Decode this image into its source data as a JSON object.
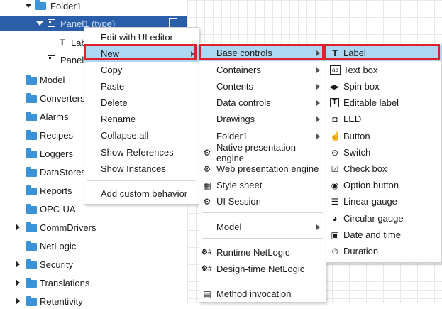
{
  "tree": {
    "folder1": "Folder1",
    "panel1": "Panel1 (type)",
    "label_child": "Lab",
    "panel_child": "Panel",
    "items": [
      {
        "label": "Model",
        "expandable": false
      },
      {
        "label": "Converters",
        "expandable": false
      },
      {
        "label": "Alarms",
        "expandable": false
      },
      {
        "label": "Recipes",
        "expandable": false
      },
      {
        "label": "Loggers",
        "expandable": false
      },
      {
        "label": "DataStores",
        "expandable": false
      },
      {
        "label": "Reports",
        "expandable": false
      },
      {
        "label": "OPC-UA",
        "expandable": false
      },
      {
        "label": "CommDrivers",
        "expandable": true
      },
      {
        "label": "NetLogic",
        "expandable": false
      },
      {
        "label": "Security",
        "expandable": true
      },
      {
        "label": "Translations",
        "expandable": true
      },
      {
        "label": "Retentivity",
        "expandable": true
      }
    ]
  },
  "menu1": {
    "edit_ui": "Edit with UI editor",
    "new": "New",
    "copy": "Copy",
    "paste": "Paste",
    "delete": "Delete",
    "rename": "Rename",
    "collapse_all": "Collapse all",
    "show_references": "Show References",
    "show_instances": "Show Instances",
    "add_custom_behavior": "Add custom behavior"
  },
  "menu2": {
    "base_controls": "Base controls",
    "containers": "Containers",
    "contents": "Contents",
    "data_controls": "Data controls",
    "drawings": "Drawings",
    "folder1": "Folder1",
    "native_engine": "Native presentation engine",
    "web_engine": "Web presentation engine",
    "style_sheet": "Style sheet",
    "ui_session": "UI Session",
    "model": "Model",
    "runtime_netlogic": "Runtime NetLogic",
    "designtime_netlogic": "Design-time NetLogic",
    "method_invocation": "Method invocation"
  },
  "menu3": {
    "label": "Label",
    "text_box": "Text box",
    "spin_box": "Spin box",
    "editable_label": "Editable label",
    "led": "LED",
    "button": "Button",
    "switch": "Switch",
    "check_box": "Check box",
    "option_button": "Option button",
    "linear_gauge": "Linear gauge",
    "circular_gauge": "Circular gauge",
    "date_and_time": "Date and time",
    "duration": "Duration"
  },
  "colors": {
    "selection": "#2a5ea8",
    "highlight": "#add8f3",
    "folder": "#3a92d8",
    "annotation": "#e0202a"
  }
}
